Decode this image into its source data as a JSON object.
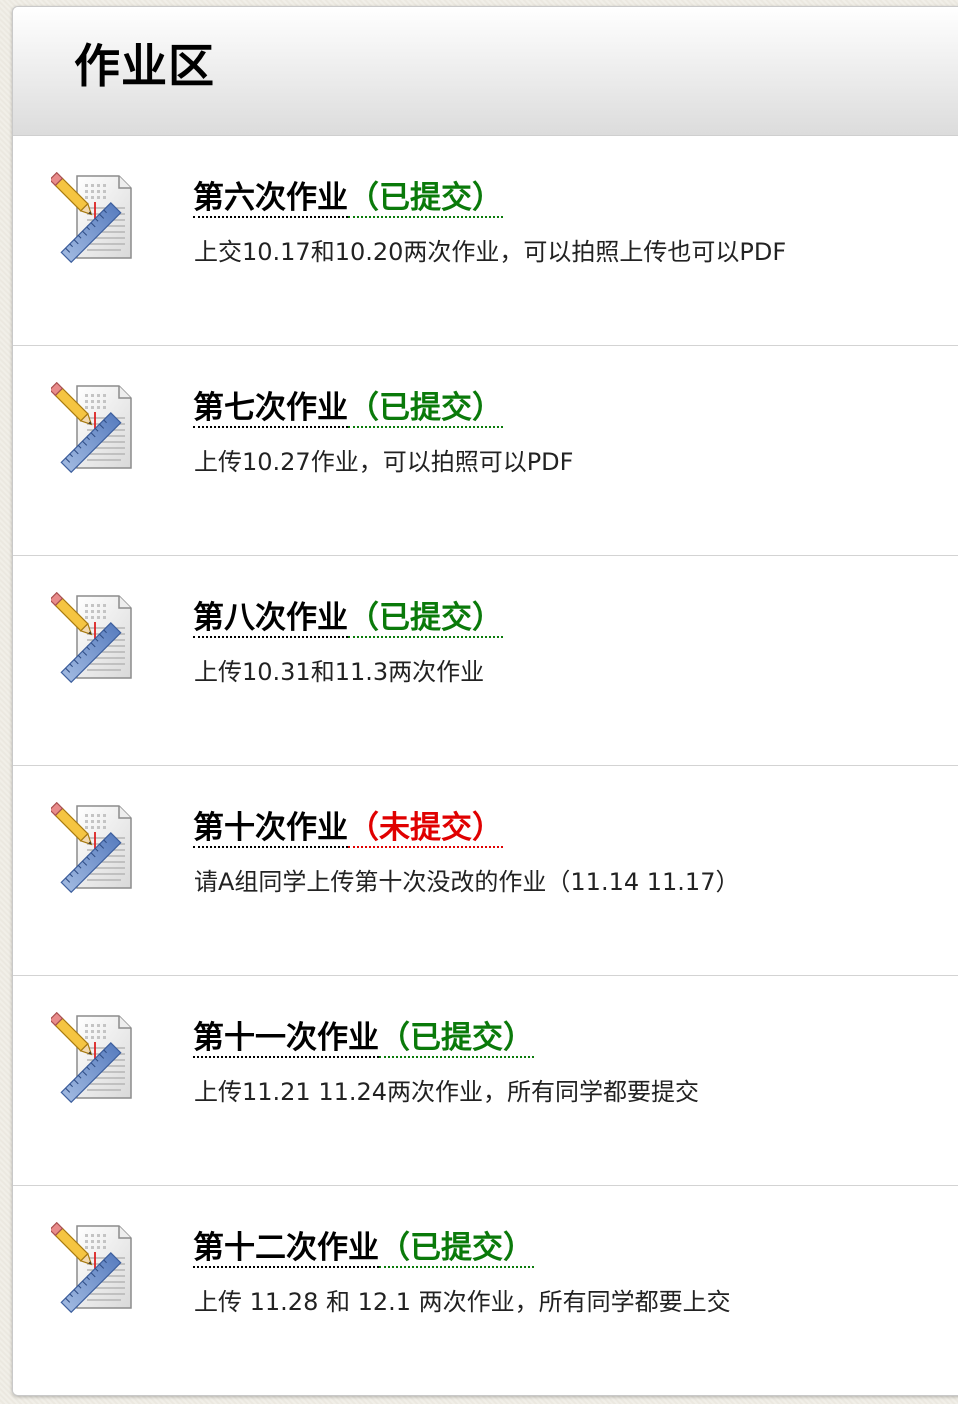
{
  "header": {
    "title": "作业区"
  },
  "assignments": [
    {
      "title": "第六次作业",
      "status": "（已提交）",
      "status_color": "#0a7a0a",
      "description": "上交10.17和10.20两次作业，可以拍照上传也可以PDF",
      "icon": "assignment-icon"
    },
    {
      "title": "第七次作业",
      "status": "（已提交）",
      "status_color": "#0a7a0a",
      "description": "上传10.27作业，可以拍照可以PDF",
      "icon": "assignment-icon"
    },
    {
      "title": "第八次作业",
      "status": "（已提交）",
      "status_color": "#0a7a0a",
      "description": "上传10.31和11.3两次作业",
      "icon": "assignment-icon"
    },
    {
      "title": "第十次作业",
      "status": "（未提交）",
      "status_color": "#e00000",
      "description": "请A组同学上传第十次没改的作业（11.14 11.17）",
      "icon": "assignment-icon"
    },
    {
      "title": "第十一次作业",
      "status": "（已提交）",
      "status_color": "#0a7a0a",
      "description": "上传11.21 11.24两次作业，所有同学都要提交",
      "icon": "assignment-icon"
    },
    {
      "title": "第十二次作业",
      "status": "（已提交）",
      "status_color": "#0a7a0a",
      "description": "上传 11.28 和 12.1 两次作业，所有同学都要上交",
      "icon": "assignment-icon"
    }
  ]
}
